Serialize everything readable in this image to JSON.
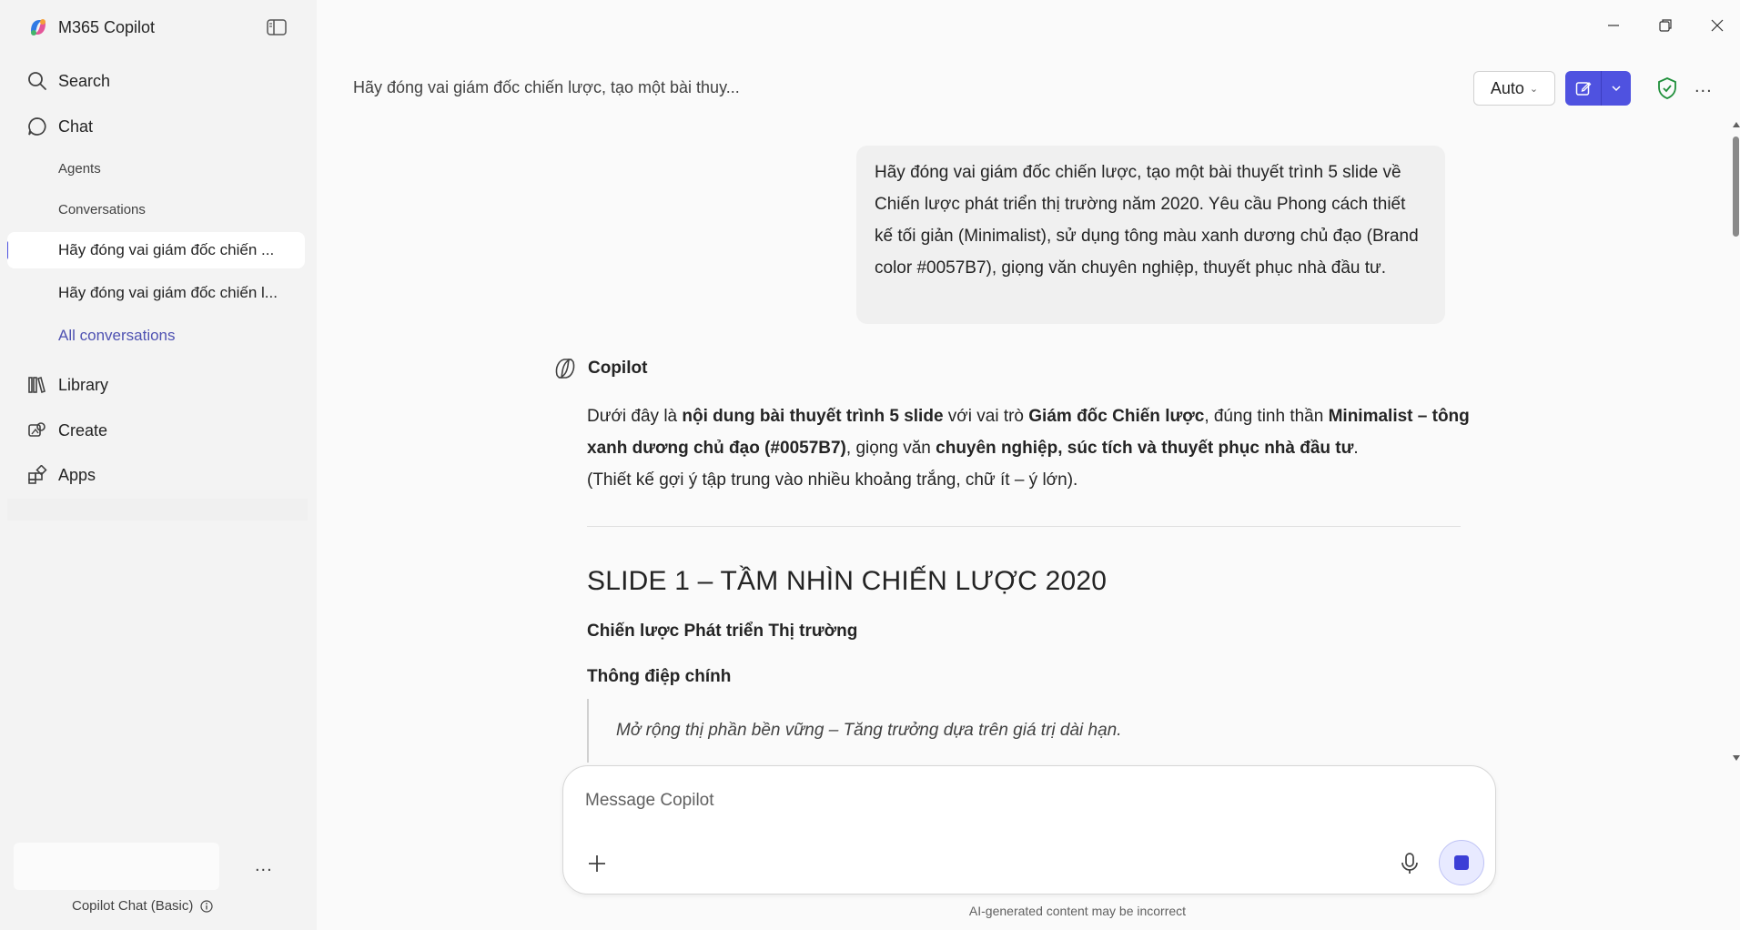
{
  "app": {
    "title": "M365 Copilot"
  },
  "sidebar": {
    "nav": {
      "search": "Search",
      "chat": "Chat",
      "library": "Library",
      "create": "Create",
      "apps": "Apps"
    },
    "chat_subitems": {
      "agents": "Agents",
      "conversations": "Conversations"
    },
    "conversations": [
      {
        "label": "Hãy đóng vai giám đốc chiến ...",
        "active": true
      },
      {
        "label": "Hãy đóng vai giám đốc chiến l...",
        "active": false
      }
    ],
    "all_conversations": "All conversations",
    "footer": {
      "more": "...",
      "plan": "Copilot Chat (Basic)"
    }
  },
  "header": {
    "conversation_title": "Hãy đóng vai giám đốc chiến lược, tạo một bài thuy...",
    "mode_label": "Auto",
    "more": "..."
  },
  "colors": {
    "accent": "#4f52e0",
    "shield": "#1f8f3a"
  },
  "chat": {
    "user_message": "Hãy đóng vai giám đốc chiến lược, tạo một bài thuyết trình 5 slide về Chiến lược phát triển thị trường năm 2020. Yêu cầu Phong cách thiết kế tối giản (Minimalist), sử dụng tông màu xanh dương chủ đạo (Brand color #0057B7), giọng văn chuyên nghiệp, thuyết phục nhà đầu tư.",
    "assistant_name": "Copilot",
    "answer": {
      "p1_a": "Dưới đây là ",
      "p1_b": "nội dung bài thuyết trình 5 slide",
      "p1_c": " với vai trò ",
      "p1_d": "Giám đốc Chiến lược",
      "p1_e": ", đúng tinh thần ",
      "p1_f": "Minimalist – tông xanh dương chủ đạo (#0057B7)",
      "p1_g": ", giọng văn ",
      "p1_h": "chuyên nghiệp, súc tích và thuyết phục nhà đầu tư",
      "p1_i": ".",
      "p2": "(Thiết kế gợi ý tập trung vào nhiều khoảng trắng, chữ ít – ý lớn).",
      "slide_title": "SLIDE 1 – TẦM NHÌN CHIẾN LƯỢC 2020",
      "subheading_1": "Chiến lược Phát triển Thị trường",
      "subheading_2": "Thông điệp chính",
      "quote": "Mở rộng thị phần bền vững – Tăng trưởng dựa trên giá trị dài hạn."
    }
  },
  "composer": {
    "placeholder": "Message Copilot",
    "value": "",
    "disclaimer": "AI-generated content may be incorrect"
  }
}
